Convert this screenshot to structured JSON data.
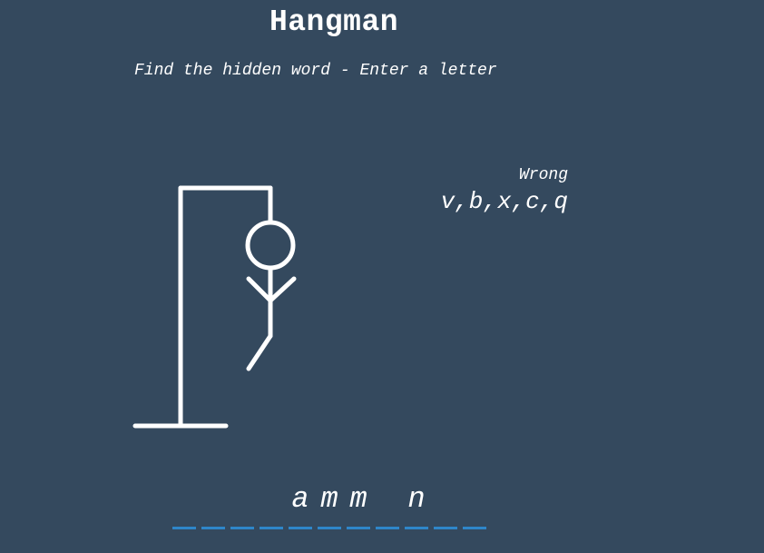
{
  "title": "Hangman",
  "subtitle": "Find the hidden word - Enter a letter",
  "wrong": {
    "heading": "Wrong",
    "letters": "v,b,x,c,q"
  },
  "word_slots": [
    "",
    "",
    "",
    "",
    "a",
    "m",
    "m",
    "",
    "n",
    "",
    ""
  ],
  "colors": {
    "background": "#34495e",
    "foreground": "#ffffff",
    "dash": "#2e86c9"
  },
  "figure_parts_shown": [
    "head",
    "body",
    "left-arm",
    "right-arm",
    "left-leg"
  ]
}
